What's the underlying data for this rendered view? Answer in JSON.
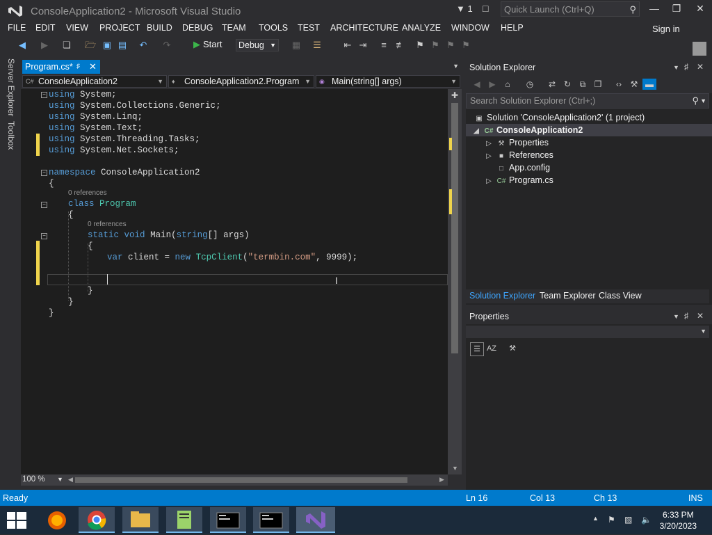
{
  "window": {
    "title": "ConsoleApplication2 - Microsoft Visual Studio",
    "notification_count": "1",
    "quick_launch_placeholder": "Quick Launch (Ctrl+Q)"
  },
  "menu": {
    "items": [
      "FILE",
      "EDIT",
      "VIEW",
      "PROJECT",
      "BUILD",
      "DEBUG",
      "TEAM",
      "TOOLS",
      "TEST",
      "ARCHITECTURE",
      "ANALYZE",
      "WINDOW",
      "HELP"
    ],
    "sign_in": "Sign in"
  },
  "toolbar": {
    "start_label": "Start",
    "configuration": "Debug"
  },
  "left_tabs": [
    "Server Explorer",
    "Toolbox"
  ],
  "document": {
    "tab_label": "Program.cs*",
    "nav_project": "ConsoleApplication2",
    "nav_class": "ConsoleApplication2.Program",
    "nav_member": "Main(string[] args)"
  },
  "code": {
    "lines": [
      [
        "using System;"
      ],
      [
        "using System.Collections.Generic;"
      ],
      [
        "using System.Linq;"
      ],
      [
        "using System.Text;"
      ],
      [
        "using System.Threading.Tasks;"
      ],
      [
        "using System.Net.Sockets;"
      ]
    ],
    "namespace_kw": "namespace",
    "namespace_name": "ConsoleApplication2",
    "open_brace": "{",
    "close_brace": "}",
    "class_refs": "0 references",
    "class_kw": "class",
    "class_name": "Program",
    "main_refs": "0 references",
    "main_static": "static",
    "main_void": "void",
    "main_sig": "Main(",
    "main_string": "string",
    "main_args": "[] args)",
    "var_kw": "var",
    "var_rest": " client = ",
    "new_kw": "new",
    "tcp_type": "TcpClient",
    "tcp_open": "(",
    "tcp_str": "\"termbin.com\"",
    "tcp_tail": ", 9999);",
    "using_kw": "using"
  },
  "editor": {
    "zoom": "100 %"
  },
  "solution_explorer": {
    "title": "Solution Explorer",
    "search_placeholder": "Search Solution Explorer (Ctrl+;)",
    "solution": "Solution 'ConsoleApplication2' (1 project)",
    "project": "ConsoleApplication2",
    "items": [
      "Properties",
      "References",
      "App.config",
      "Program.cs"
    ],
    "tabs": [
      "Solution Explorer",
      "Team Explorer",
      "Class View"
    ]
  },
  "properties": {
    "title": "Properties"
  },
  "status": {
    "ready": "Ready",
    "ln": "Ln 16",
    "col": "Col 13",
    "ch": "Ch 13",
    "mode": "INS"
  },
  "taskbar": {
    "time": "6:33 PM",
    "date": "3/20/2023"
  },
  "colors": {
    "accent": "#007acc",
    "editor_bg": "#1e1e1e",
    "keyword": "#569cd6",
    "type": "#4ec9b0",
    "string": "#d69d85",
    "change_marker": "#efd44c"
  }
}
